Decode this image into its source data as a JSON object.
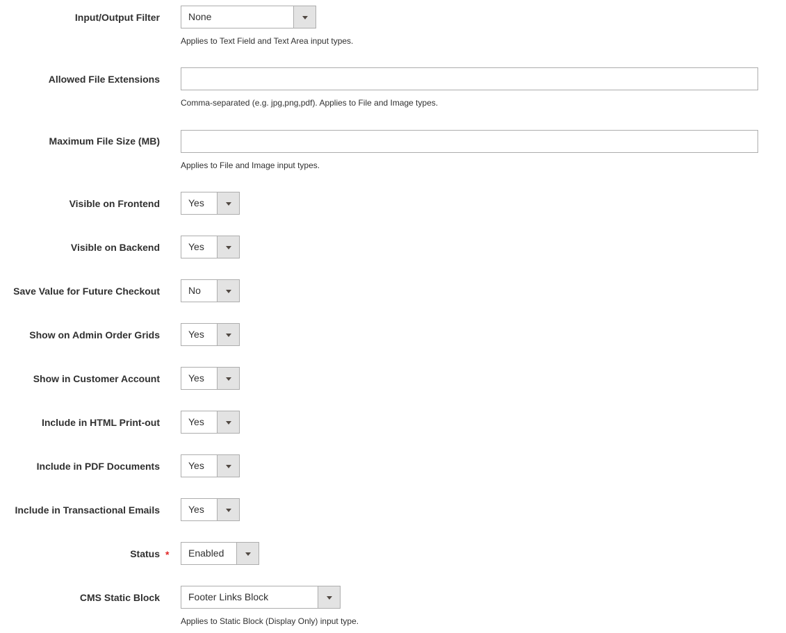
{
  "fields": [
    {
      "label": "Input/Output Filter",
      "value": "None",
      "note": "Applies to Text Field and Text Area input types."
    },
    {
      "label": "Allowed File Extensions",
      "value": "",
      "placeholder": "",
      "note": "Comma-separated (e.g. jpg,png,pdf). Applies to File and Image types."
    },
    {
      "label": "Maximum File Size (MB)",
      "value": "",
      "placeholder": "",
      "note": "Applies to File and Image input types."
    },
    {
      "label": "Visible on Frontend",
      "value": "Yes"
    },
    {
      "label": "Visible on Backend",
      "value": "Yes"
    },
    {
      "label": "Save Value for Future Checkout",
      "value": "No"
    },
    {
      "label": "Show on Admin Order Grids",
      "value": "Yes"
    },
    {
      "label": "Show in Customer Account",
      "value": "Yes"
    },
    {
      "label": "Include in HTML Print-out",
      "value": "Yes"
    },
    {
      "label": "Include in PDF Documents",
      "value": "Yes"
    },
    {
      "label": "Include in Transactional Emails",
      "value": "Yes"
    },
    {
      "label": "Status",
      "required_mark": "*",
      "value": "Enabled"
    },
    {
      "label": "CMS Static Block",
      "value": "Footer Links Block",
      "note": "Applies to Static Block (Display Only) input type."
    }
  ],
  "colors": {
    "required": "#e22626",
    "border": "#adadad",
    "arrow_bg": "#e3e3e3",
    "text": "#303030"
  }
}
